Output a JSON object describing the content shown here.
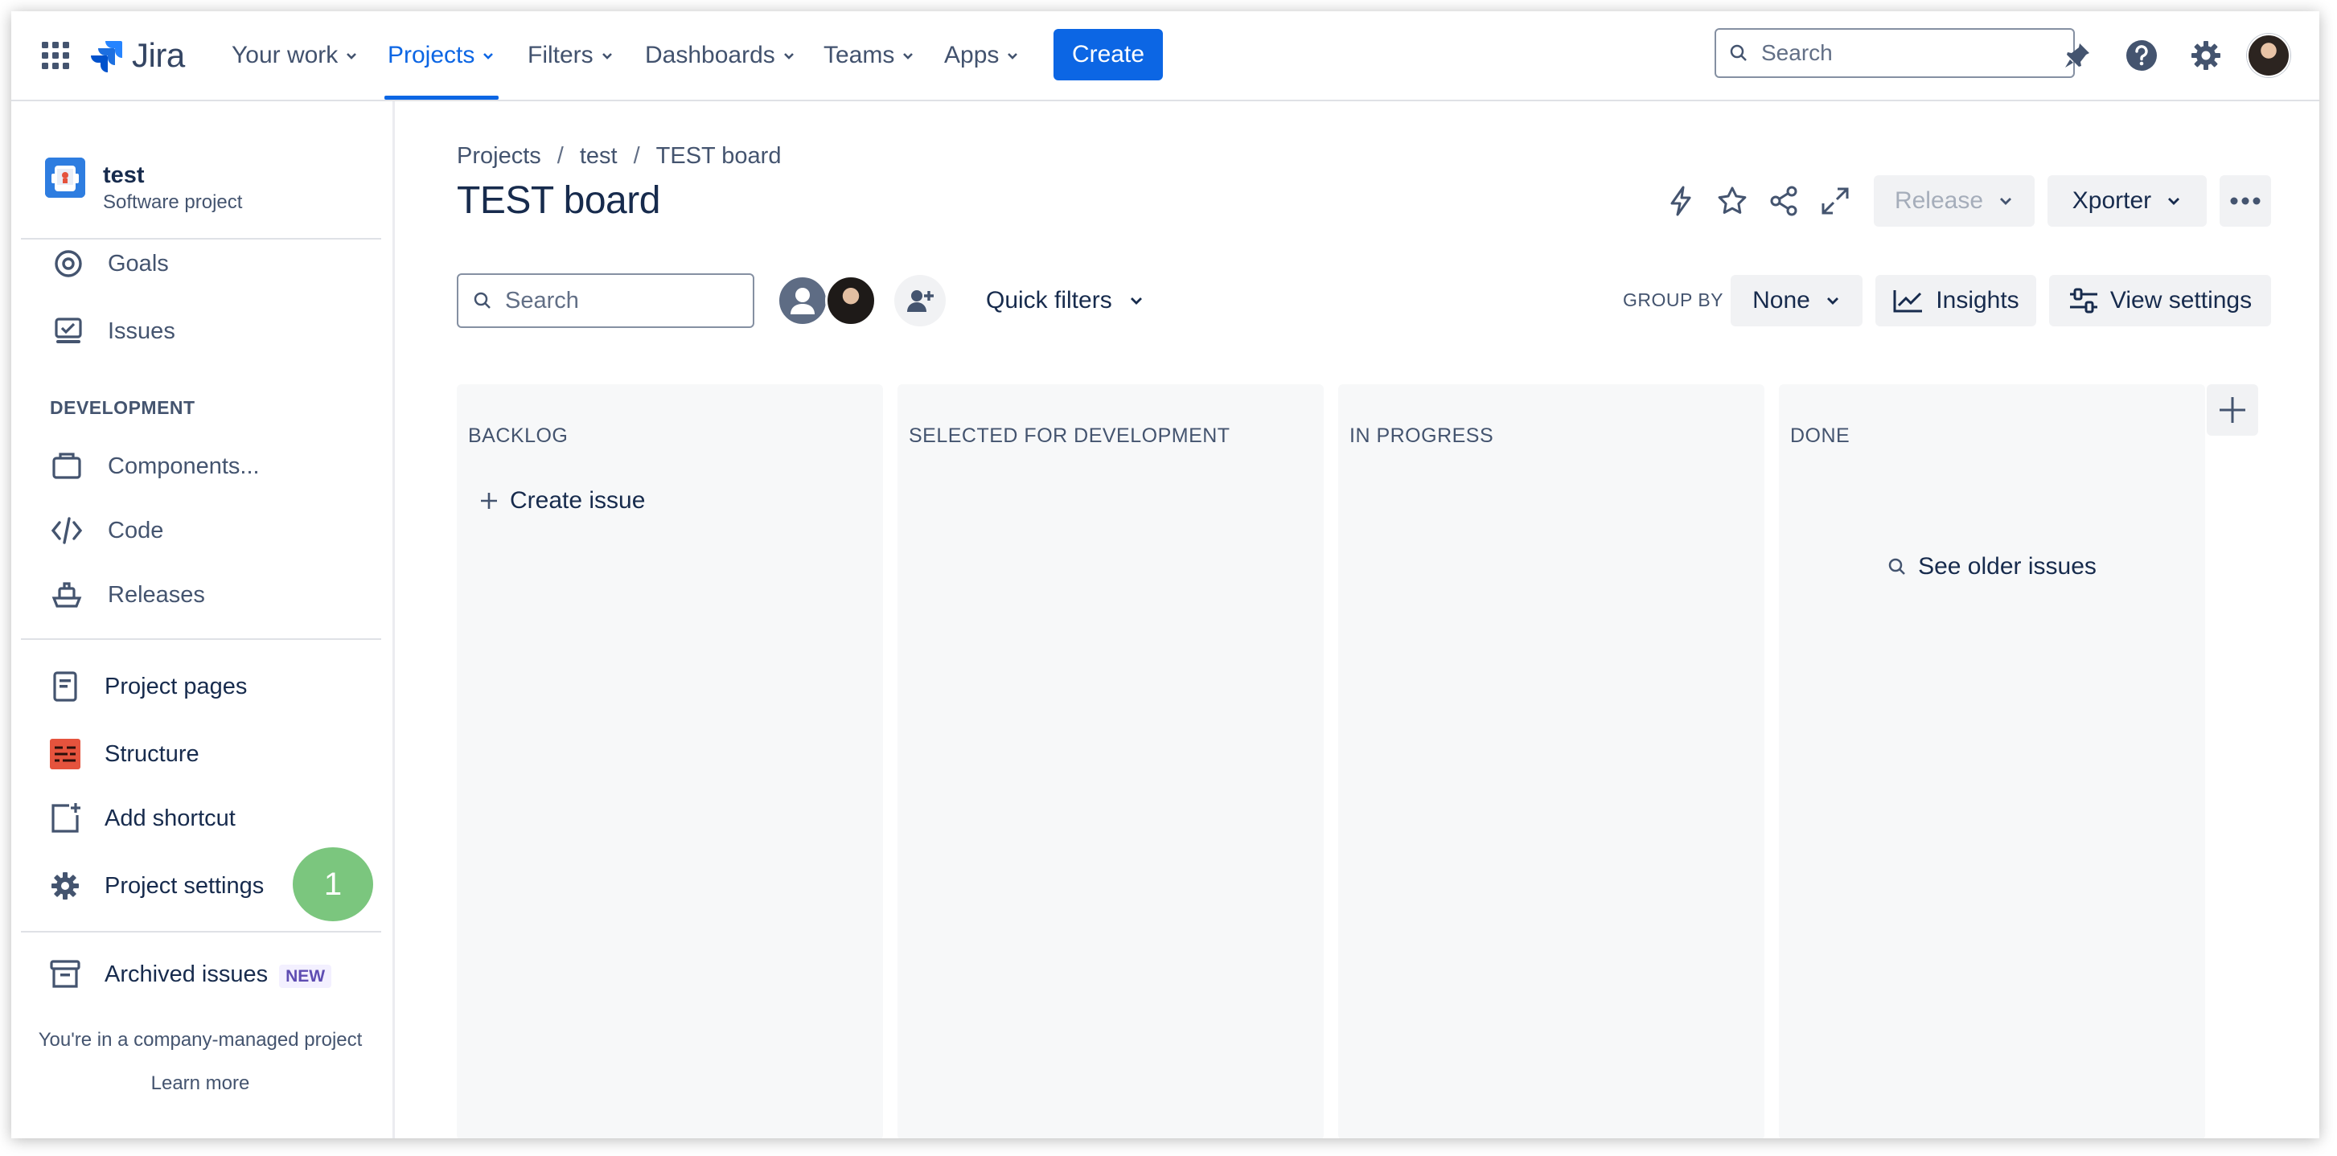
{
  "topnav": {
    "logo": "Jira",
    "items": [
      {
        "label": "Your work",
        "active": false
      },
      {
        "label": "Projects",
        "active": true
      },
      {
        "label": "Filters",
        "active": false
      },
      {
        "label": "Dashboards",
        "active": false
      },
      {
        "label": "Teams",
        "active": false
      },
      {
        "label": "Apps",
        "active": false
      }
    ],
    "create_label": "Create",
    "search_placeholder": "Search"
  },
  "sidebar": {
    "project_name": "test",
    "project_type": "Software project",
    "planning": [
      {
        "label": "Goals",
        "icon": "target-icon"
      },
      {
        "label": "Issues",
        "icon": "issues-icon"
      }
    ],
    "development_heading": "DEVELOPMENT",
    "development": [
      {
        "label": "Components...",
        "icon": "component-icon"
      },
      {
        "label": "Code",
        "icon": "code-icon"
      },
      {
        "label": "Releases",
        "icon": "ship-icon"
      }
    ],
    "extras": [
      {
        "label": "Project pages",
        "icon": "page-icon"
      },
      {
        "label": "Structure",
        "icon": "structure-icon"
      },
      {
        "label": "Add shortcut",
        "icon": "add-shortcut-icon"
      },
      {
        "label": "Project settings",
        "icon": "gear-icon"
      }
    ],
    "step_badge": "1",
    "archived_label": "Archived issues",
    "archived_badge": "NEW",
    "company_note": "You're in a company-managed project",
    "learn_more": "Learn more"
  },
  "board": {
    "breadcrumb": [
      "Projects",
      "test",
      "TEST board"
    ],
    "title": "TEST board",
    "release_label": "Release",
    "xporter_label": "Xporter",
    "search_placeholder": "Search",
    "quick_filters_label": "Quick filters",
    "group_by_label": "GROUP BY",
    "group_by_value": "None",
    "insights_label": "Insights",
    "view_settings_label": "View settings",
    "columns": [
      {
        "title": "BACKLOG"
      },
      {
        "title": "SELECTED FOR DEVELOPMENT"
      },
      {
        "title": "IN PROGRESS"
      },
      {
        "title": "DONE"
      }
    ],
    "create_issue_label": "Create issue",
    "see_older_label": "See older issues"
  },
  "colors": {
    "accent": "#0c66e4",
    "badge_green": "#7bc67e",
    "column_bg": "#f7f8f9",
    "structure_red": "#e5533d"
  }
}
